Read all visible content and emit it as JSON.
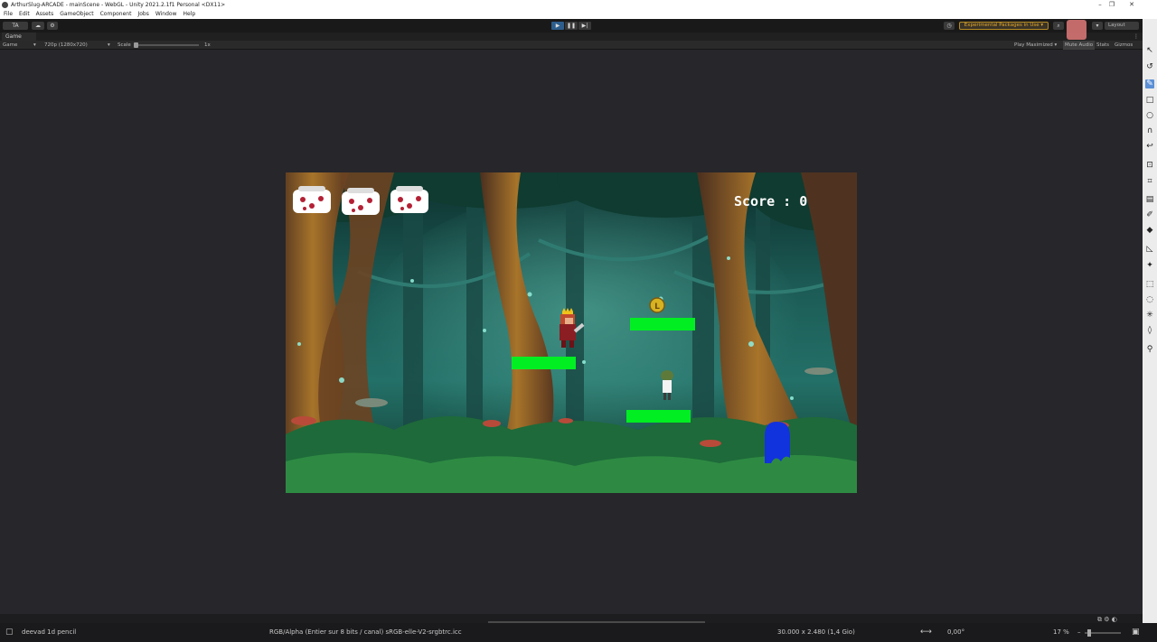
{
  "window": {
    "title": "ArthurSlug-ARCADE - mainScene - WebGL - Unity 2021.2.1f1 Personal <DX11>",
    "controls": [
      "–",
      "❐",
      "✕"
    ]
  },
  "menu": [
    "File",
    "Edit",
    "Assets",
    "GameObject",
    "Component",
    "Jobs",
    "Window",
    "Help"
  ],
  "toolbar": {
    "account": "TA",
    "play_controls": [
      "▶",
      "❚❚",
      "▶|"
    ],
    "experimental_label": "Experimental Packages in Use ▾",
    "layout_label": "Layout"
  },
  "game_tab": {
    "label": "Game",
    "display": "Game",
    "resolution": "720p (1280x720)",
    "scale_label": "Scale",
    "scale_value": "1x",
    "play_maximized": "Play Maximized ▾",
    "mute_audio": "Mute Audio",
    "stats": "Stats",
    "gizmos": "Gizmos"
  },
  "game": {
    "score_text": "Score : 0",
    "lives": 3,
    "colors": {
      "platform": "#00ee22",
      "blob": "#1133dd"
    }
  },
  "statusbar": {
    "left": "deevad 1d pencil",
    "color_profile": "RGB/Alpha (Entier sur 8 bits / canal) sRGB-elle-V2-srgbtrc.icc",
    "dimensions": "30.000 x 2.480 (1,4 Gio)",
    "angle": "0,00°",
    "zoom": "17 %"
  }
}
